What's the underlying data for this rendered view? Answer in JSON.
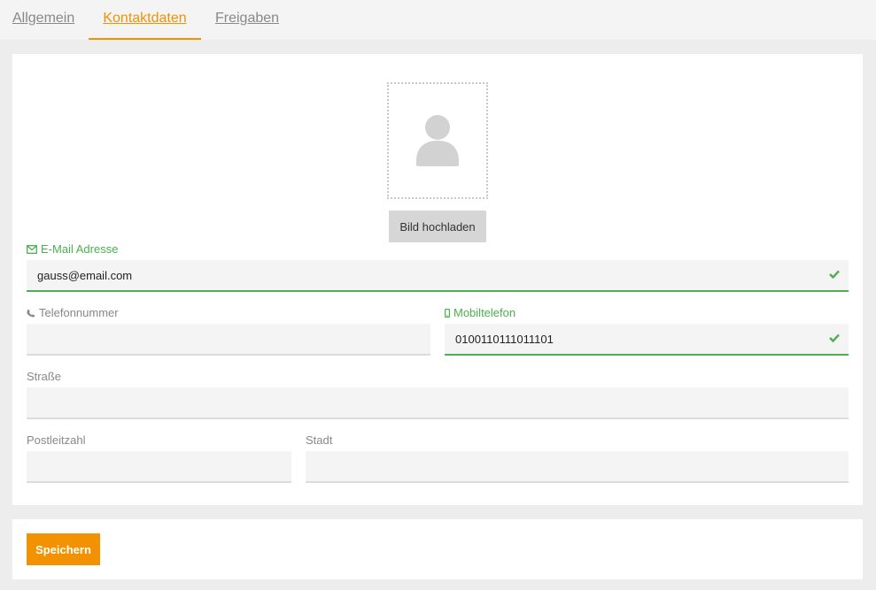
{
  "tabs": [
    {
      "label": "Allgemein",
      "active": false
    },
    {
      "label": "Kontaktdaten",
      "active": true
    },
    {
      "label": "Freigaben",
      "active": false
    }
  ],
  "avatar": {
    "upload_label": "Bild hochladen",
    "icon": "user-silhouette-icon"
  },
  "form": {
    "email": {
      "label": "E-Mail Adresse",
      "value": "gauss@email.com",
      "valid": true,
      "icon": "envelope-icon"
    },
    "phone": {
      "label": "Telefonnummer",
      "value": "",
      "icon": "phone-icon"
    },
    "mobile": {
      "label": "Mobiltelefon",
      "value": "0100110111011101",
      "valid": true,
      "icon": "mobile-icon"
    },
    "street": {
      "label": "Straße",
      "value": ""
    },
    "zip": {
      "label": "Postleitzahl",
      "value": ""
    },
    "city": {
      "label": "Stadt",
      "value": ""
    }
  },
  "actions": {
    "save_label": "Speichern"
  },
  "colors": {
    "accent": "#f39200",
    "valid": "#4caf50",
    "field_bg": "#f4f4f4",
    "page_bg": "#ededed"
  }
}
